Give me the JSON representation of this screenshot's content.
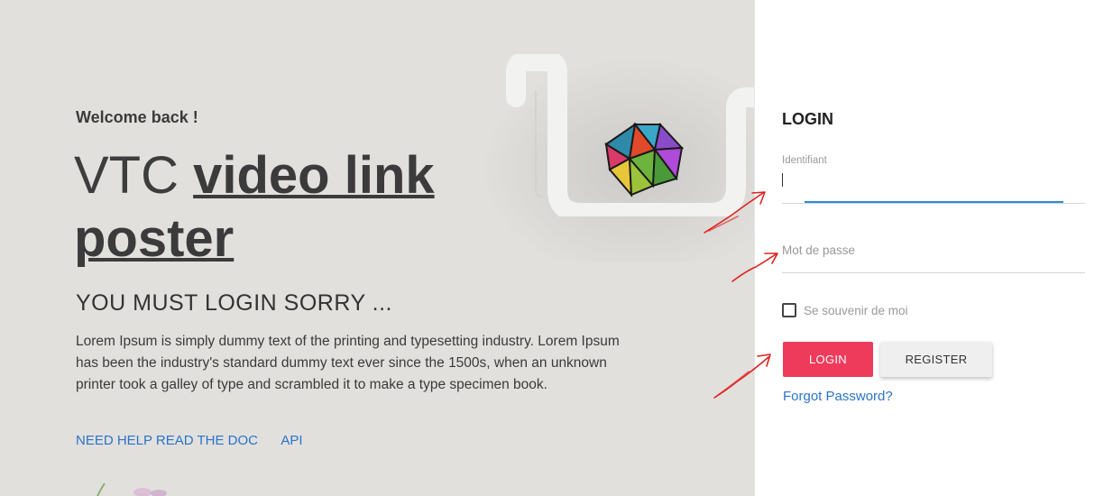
{
  "hero": {
    "welcome": "Welcome back !",
    "title_prefix": "VTC",
    "title_link": "video link poster",
    "subtitle": "YOU MUST LOGIN SORRY ...",
    "description": "Lorem Ipsum is simply dummy text of the printing and typesetting industry. Lorem Ipsum has been the industry's standard dummy text ever since the 1500s, when an unknown printer took a galley of type and scrambled it to make a type specimen book.",
    "links": [
      "NEED HELP READ THE DOC",
      "API"
    ]
  },
  "login": {
    "title": "LOGIN",
    "username_label": "Identifiant",
    "username_value": "",
    "password_placeholder": "Mot de passe",
    "remember_label": "Se souvenir de moi",
    "remember_checked": false,
    "login_button": "LOGIN",
    "register_button": "REGISTER",
    "forgot_link": "Forgot Password?"
  },
  "colors": {
    "hero_bg": "#e1e0dd",
    "accent_red": "#ee3a5b",
    "link_blue": "#2b74c9",
    "focus_blue": "#2b8cd8",
    "annotation_red": "#e0201e"
  }
}
